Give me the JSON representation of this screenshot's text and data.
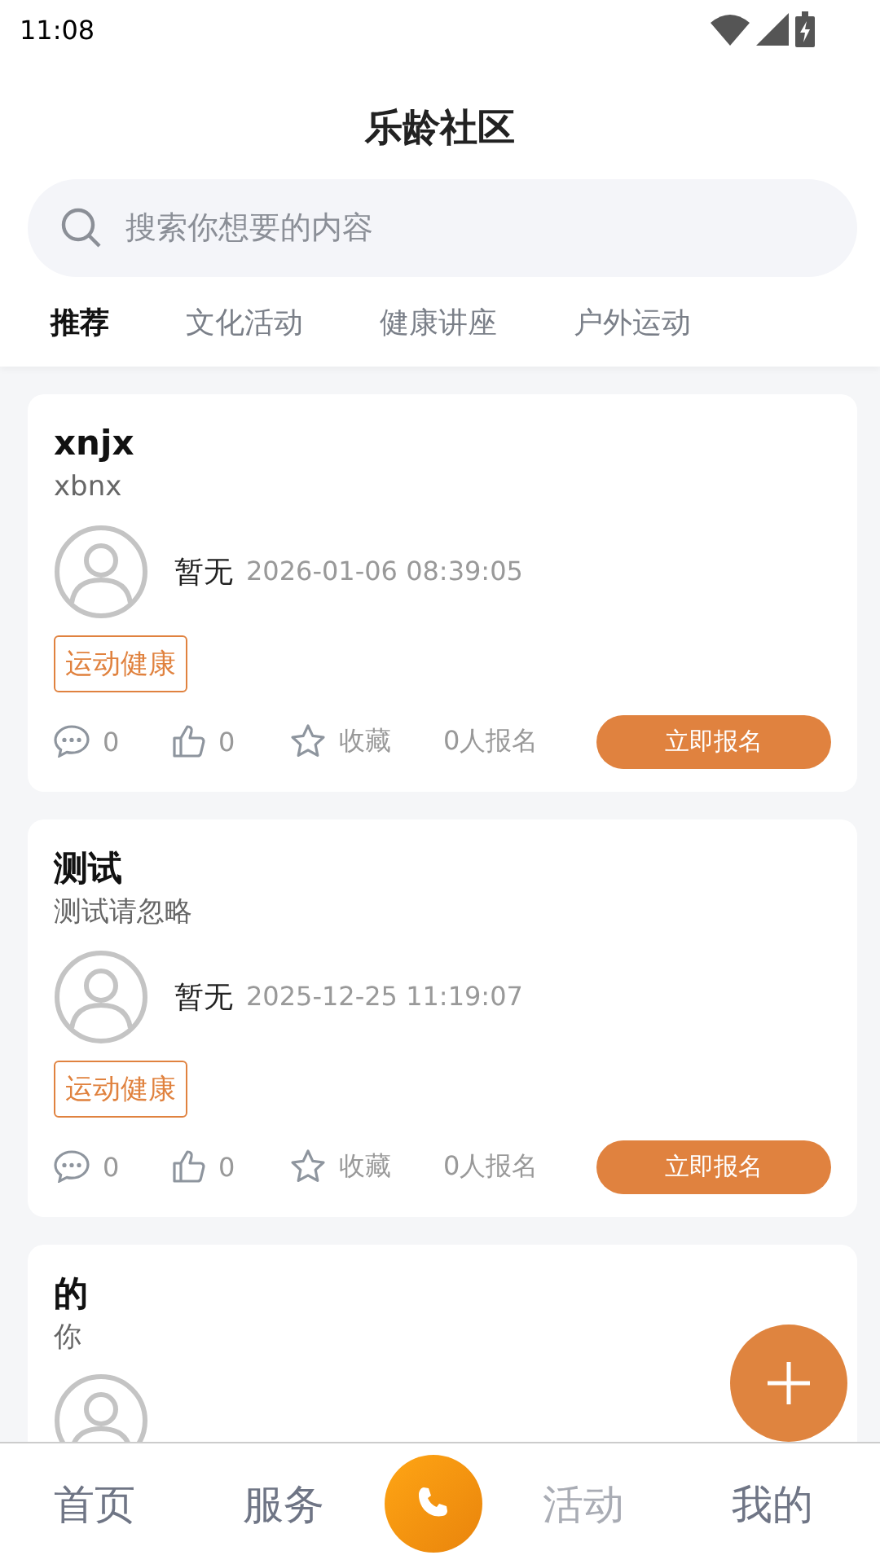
{
  "status_bar": {
    "time": "11:08"
  },
  "header": {
    "title": "乐龄社区"
  },
  "search": {
    "placeholder": "搜索你想要的内容"
  },
  "tabs": [
    {
      "label": "推荐",
      "selected": true
    },
    {
      "label": "文化活动",
      "selected": false
    },
    {
      "label": "健康讲座",
      "selected": false
    },
    {
      "label": "户外运动",
      "selected": false
    }
  ],
  "posts": [
    {
      "title": "xnjx",
      "subtitle": "xbnx",
      "author": "暂无",
      "time": "2026-01-06 08:39:05",
      "tag": "运动健康",
      "comments": "0",
      "likes": "0",
      "favorite": "收藏",
      "signups": "0人报名",
      "action": "立即报名"
    },
    {
      "title": "测试",
      "subtitle": "测试请忽略",
      "author": "暂无",
      "time": "2025-12-25 11:19:07",
      "tag": "运动健康",
      "comments": "0",
      "likes": "0",
      "favorite": "收藏",
      "signups": "0人报名",
      "action": "立即报名"
    },
    {
      "title": "的",
      "subtitle": "你"
    }
  ],
  "bottom_nav": [
    {
      "label": "首页",
      "selected": false
    },
    {
      "label": "服务",
      "selected": false
    },
    {
      "kind": "call"
    },
    {
      "label": "活动",
      "selected": true
    },
    {
      "label": "我的",
      "selected": false
    }
  ]
}
